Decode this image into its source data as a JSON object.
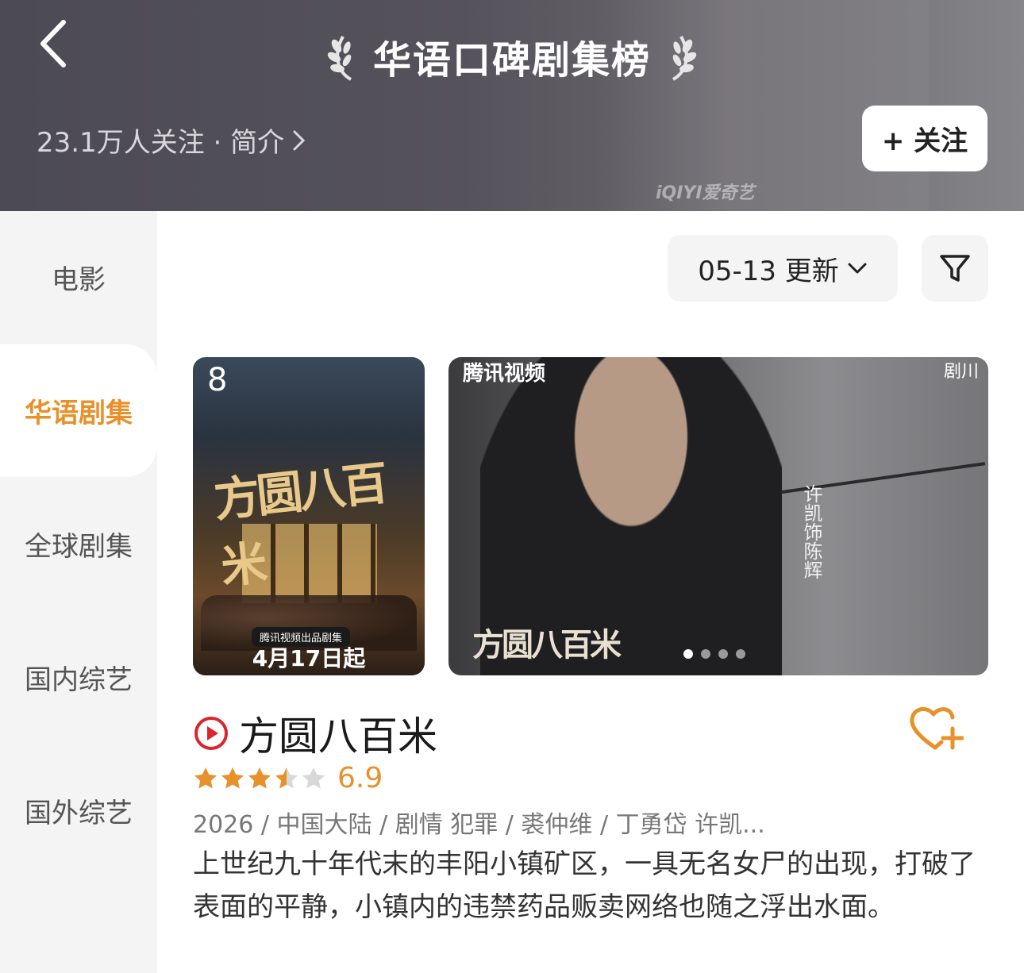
{
  "header": {
    "title": "华语口碑剧集榜",
    "followers_text": "23.1万人关注 · 简介",
    "follow_button": "+ 关注",
    "watermark": "iQIYI爱奇艺"
  },
  "sidebar": {
    "items": [
      {
        "label": "电影",
        "active": false
      },
      {
        "label": "华语剧集",
        "active": true
      },
      {
        "label": "全球剧集",
        "active": false
      },
      {
        "label": "国内综艺",
        "active": false
      },
      {
        "label": "国外综艺",
        "active": false
      }
    ]
  },
  "controls": {
    "update_label": "05-13 更新"
  },
  "show": {
    "rank": "8",
    "poster_title": "方圆八百米",
    "poster_tag": "腾讯视频出品剧集",
    "poster_date": "4月17日起",
    "banner_source": "腾讯视频",
    "banner_source_right": "剧川",
    "banner_vertical_text": "许凯饰陈辉",
    "banner_title": "方圆八百米",
    "banner_dots": 4,
    "banner_active_dot": 0,
    "title": "方圆八百米",
    "rating": 6.9,
    "rating_text": "6.9",
    "stars_filled": 3.5,
    "stars_total": 5,
    "meta": "2026 / 中国大陆 / 剧情 犯罪 / 裘仲维 / 丁勇岱 许凯...",
    "description": "上世纪九十年代末的丰阳小镇矿区，一具无名女尸的出现，打破了表面的平静，小镇内的违禁药品贩卖网络也随之浮出水面。"
  },
  "colors": {
    "accent": "#e8902a",
    "play_icon": "#d9262c",
    "header_bg": "#4c4a52",
    "sidebar_bg": "#f4f4f4"
  }
}
